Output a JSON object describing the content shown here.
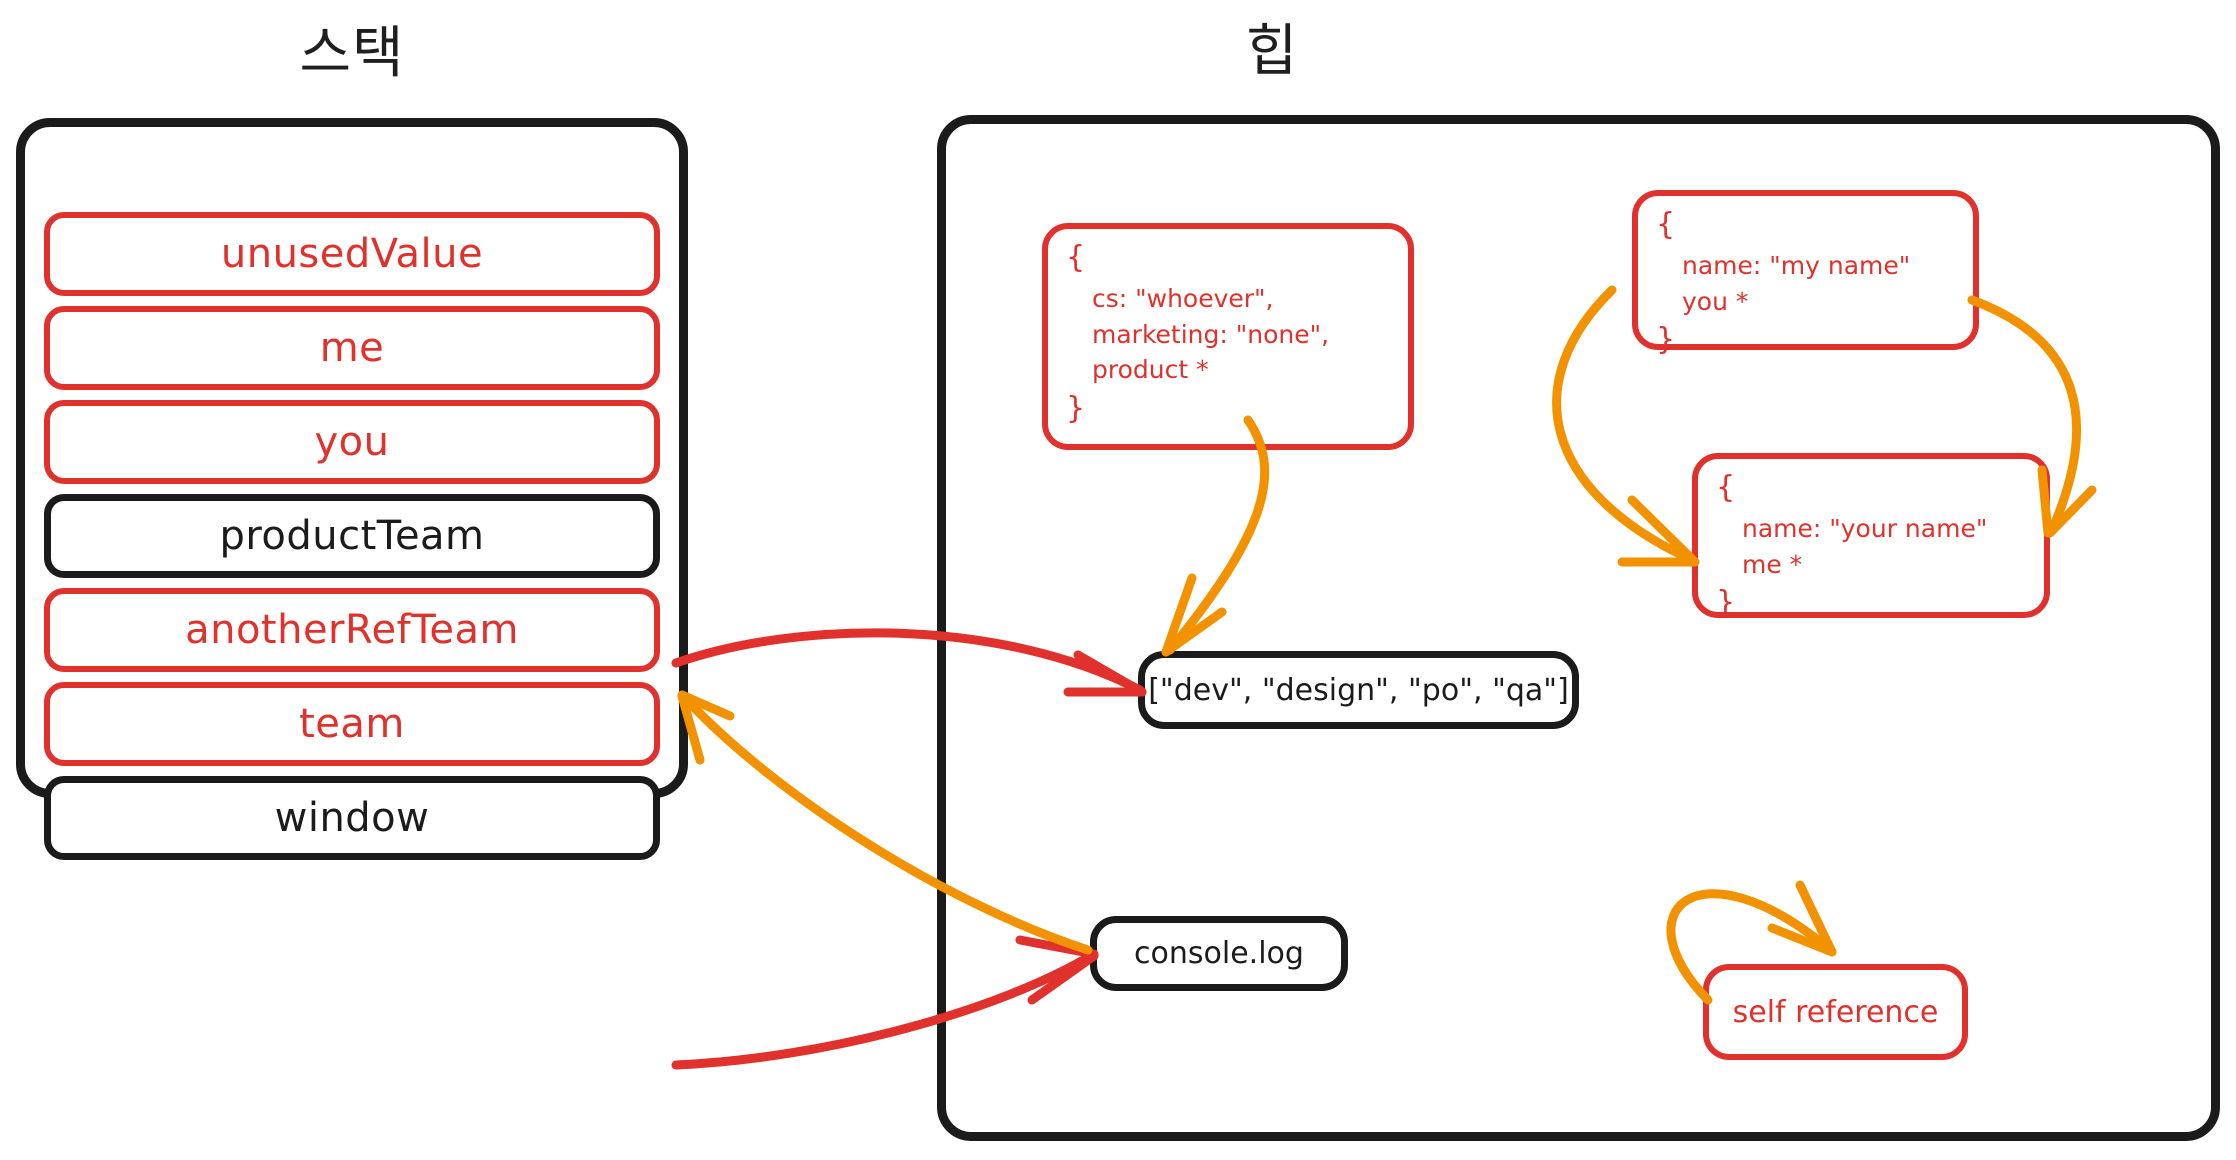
{
  "colors": {
    "red": "#e0312c",
    "black": "#1b1b1b",
    "orange": "#f29200",
    "background": "#ffffff"
  },
  "stack": {
    "title": "스택",
    "frames": [
      {
        "label": "unusedValue",
        "color": "red"
      },
      {
        "label": "me",
        "color": "red"
      },
      {
        "label": "you",
        "color": "red"
      },
      {
        "label": "productTeam",
        "color": "black"
      },
      {
        "label": "anotherRefTeam",
        "color": "red"
      },
      {
        "label": "team",
        "color": "red"
      },
      {
        "label": "window",
        "color": "black"
      }
    ]
  },
  "heap": {
    "title": "힙",
    "nodes": {
      "product_team_object": {
        "kind": "object",
        "color": "red",
        "open_brace": "{",
        "close_brace": "}",
        "lines": [
          "cs: \"whoever\",",
          "marketing: \"none\",",
          "product *"
        ]
      },
      "my_name_object": {
        "kind": "object",
        "color": "red",
        "open_brace": "{",
        "close_brace": "}",
        "lines": [
          "name: \"my name\"",
          "you *"
        ]
      },
      "your_name_object": {
        "kind": "object",
        "color": "red",
        "open_brace": "{",
        "close_brace": "}",
        "lines": [
          "name: \"your name\"",
          "me *"
        ]
      },
      "team_array": {
        "kind": "value",
        "color": "black",
        "label": "[\"dev\", \"design\", \"po\", \"qa\"]"
      },
      "console_log": {
        "kind": "value",
        "color": "black",
        "label": "console.log"
      },
      "self_reference": {
        "kind": "value",
        "color": "red",
        "label": "self reference"
      }
    }
  },
  "arrows": [
    {
      "name": "product-team-to-array",
      "color": "red",
      "from": "stack-frame-productTeam",
      "to": "team-array"
    },
    {
      "name": "window-to-console-log",
      "color": "red",
      "from": "stack-frame-window",
      "to": "console-log"
    },
    {
      "name": "console-log-to-product-team",
      "color": "orange",
      "from": "console-log",
      "to": "stack-frame-productTeam"
    },
    {
      "name": "product-prop-to-array",
      "color": "orange",
      "from": "product-team-object",
      "to": "team-array"
    },
    {
      "name": "my-name-to-your-name-left",
      "color": "orange",
      "from": "my-name-object",
      "to": "your-name-object"
    },
    {
      "name": "my-name-to-your-name-right",
      "color": "orange",
      "from": "my-name-object",
      "to": "your-name-object"
    },
    {
      "name": "self-reference-loop",
      "color": "orange",
      "from": "self-reference",
      "to": "self-reference"
    }
  ]
}
